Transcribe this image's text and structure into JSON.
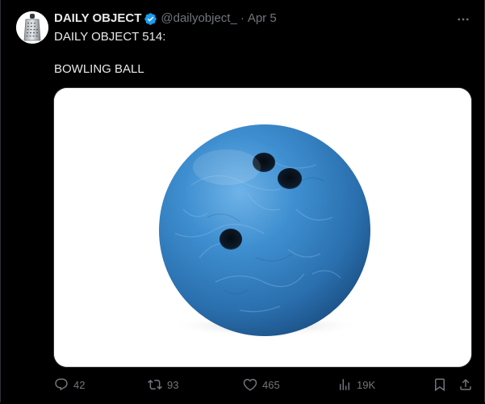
{
  "account": {
    "name": "DAILY OBJECT",
    "handle": "@dailyobject_",
    "separator": "·",
    "date": "Apr 5",
    "verified": true,
    "avatar_icon": "cheese-grater-icon"
  },
  "post": {
    "line1": "DAILY OBJECT 514:",
    "line2": "BOWLING BALL",
    "media_subject": "bowling-ball"
  },
  "actions": {
    "replies": "42",
    "reposts": "93",
    "likes": "465",
    "views": "19K"
  },
  "colors": {
    "background": "#000000",
    "text_primary": "#e7e9ea",
    "text_secondary": "#71767b",
    "verified_badge": "#1d9bf0",
    "ball": "#2f7fc1"
  }
}
